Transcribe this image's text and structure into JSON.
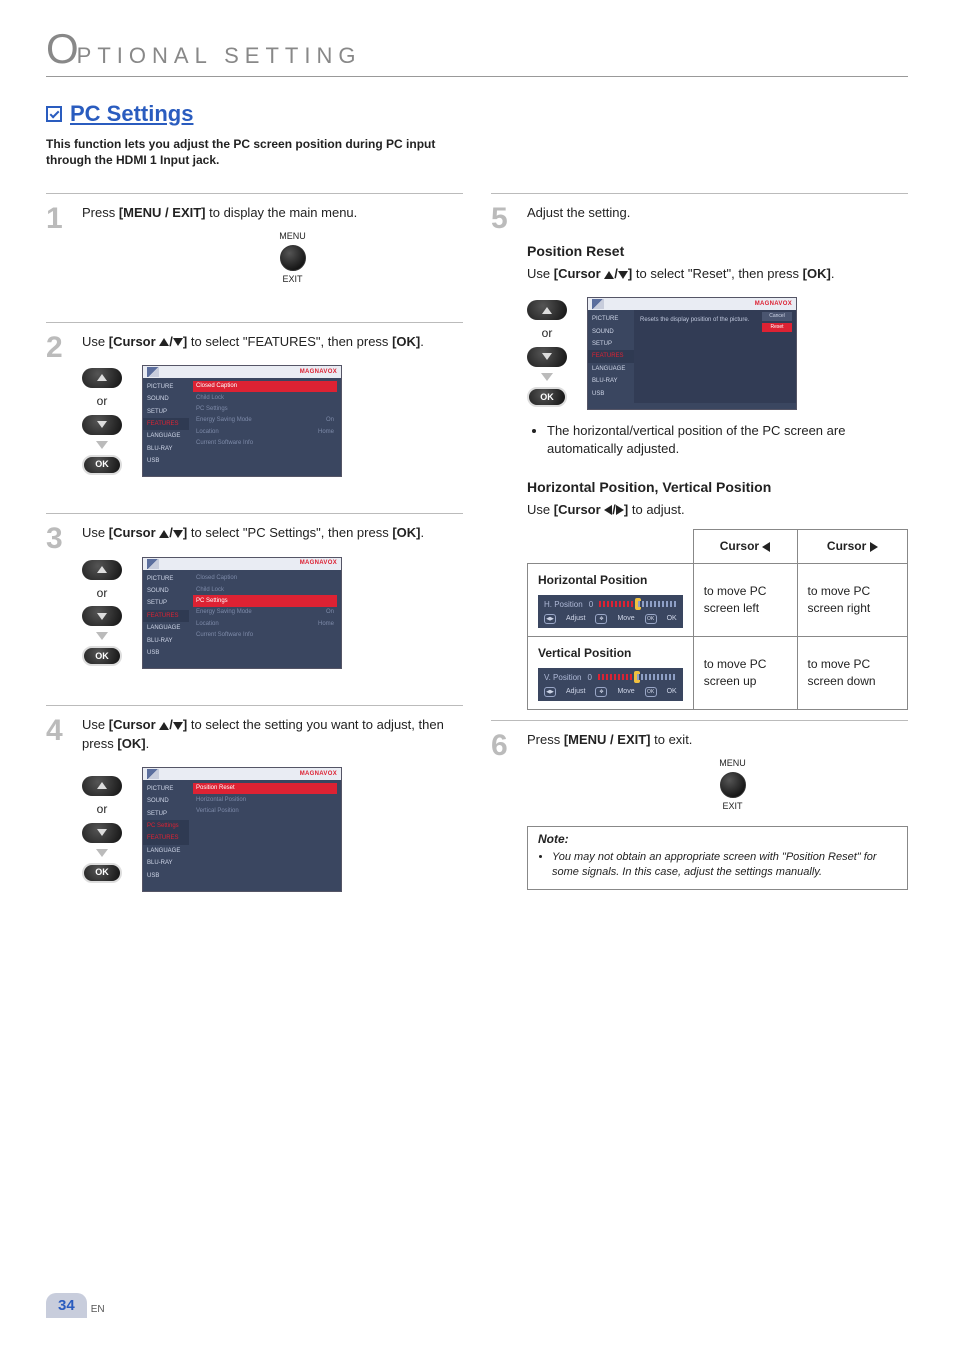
{
  "header": {
    "cap": "O",
    "rest": "PTIONAL  SETTING"
  },
  "section": {
    "title": "PC Settings",
    "description": "This function lets you adjust the PC screen position during PC input through the HDMI 1 Input jack."
  },
  "remote": {
    "menu": "MENU",
    "exit": "EXIT",
    "ok": "OK",
    "or": "or"
  },
  "steps": {
    "s1": {
      "num": "1",
      "pre": "Press ",
      "bold": "[MENU / EXIT]",
      "post": " to display the main menu."
    },
    "s2": {
      "num": "2",
      "pre": "Use ",
      "bold": "[Cursor ",
      "mid": "]",
      "post": " to select \"FEATURES\", then press ",
      "ok": "[OK]",
      "end": "."
    },
    "s3": {
      "num": "3",
      "pre": "Use ",
      "bold": "[Cursor ",
      "mid": "]",
      "post": " to select \"PC Settings\", then press ",
      "ok": "[OK]",
      "end": "."
    },
    "s4": {
      "num": "4",
      "pre": "Use ",
      "bold": "[Cursor ",
      "mid": "]",
      "post": " to select the setting you want to adjust, then press ",
      "ok": "[OK]",
      "end": "."
    },
    "s5": {
      "num": "5",
      "text": "Adjust the setting."
    },
    "s6": {
      "num": "6",
      "pre": "Press ",
      "bold": "[MENU / EXIT]",
      "post": " to exit."
    }
  },
  "reset": {
    "heading": "Position Reset",
    "pre": "Use ",
    "bold": "[Cursor ",
    "mid": "]",
    "post": " to select \"Reset\", then press ",
    "ok": "[OK]",
    "end": ".",
    "bullet": "The horizontal/vertical position of the PC screen are automatically adjusted."
  },
  "hv": {
    "heading": "Horizontal Position, Vertical Position",
    "pre": "Use ",
    "bold": "[Cursor ",
    "mid": "]",
    "post": " to adjust."
  },
  "table": {
    "head_left": "Cursor ",
    "head_right": "Cursor ",
    "rows": [
      {
        "title": "Horizontal Position",
        "bar_label": "H. Position",
        "bar_value": "0",
        "left": "to move PC screen left",
        "right": "to move PC screen right"
      },
      {
        "title": "Vertical Position",
        "bar_label": "V. Position",
        "bar_value": "0",
        "left": "to move PC screen up",
        "right": "to move PC screen down"
      }
    ],
    "adjust": "Adjust",
    "move": "Move",
    "ok": "OK"
  },
  "note": {
    "title": "Note:",
    "item": "You may not obtain an appropriate screen with \"Position Reset\" for some signals. In this case, adjust the settings manually."
  },
  "osd": {
    "brand": "MAGNAVOX",
    "sidebar": [
      "PICTURE",
      "SOUND",
      "SETUP",
      "FEATURES",
      "LANGUAGE",
      "BLU-RAY",
      "USB"
    ],
    "menu2": [
      {
        "label": "Closed Caption",
        "val": ""
      },
      {
        "label": "Child Lock",
        "val": ""
      },
      {
        "label": "PC Settings",
        "val": ""
      },
      {
        "label": "Energy Saving Mode",
        "val": "On"
      },
      {
        "label": "Location",
        "val": "Home"
      },
      {
        "label": "Current Software Info",
        "val": ""
      }
    ],
    "menu4": [
      {
        "label": "Position Reset",
        "val": ""
      },
      {
        "label": "Horizontal Position",
        "val": ""
      },
      {
        "label": "Vertical Position",
        "val": ""
      }
    ],
    "resetPanel": {
      "desc": "Resets the display position of the picture.",
      "cancel": "Cancel",
      "reset": "Reset"
    }
  },
  "page": {
    "num": "34",
    "lang": "EN"
  }
}
